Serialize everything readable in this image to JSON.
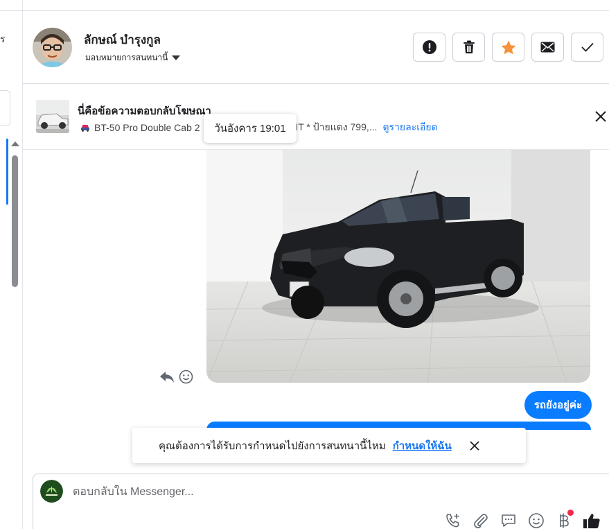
{
  "left_strip": {
    "cut_text": "ร"
  },
  "conversation": {
    "contact_name": "ลักษณ์ บำรุงกูล",
    "assign_label": "มอบหมายการสนทนานี้"
  },
  "header_actions": [
    {
      "name": "spam-button",
      "icon": "exclamation-icon"
    },
    {
      "name": "delete-button",
      "icon": "trash-icon"
    },
    {
      "name": "star-button",
      "icon": "star-icon"
    },
    {
      "name": "mark-unread-button",
      "icon": "envelope-icon"
    },
    {
      "name": "mark-done-button",
      "icon": "check-icon"
    }
  ],
  "ad_reply": {
    "title": "นี่คือข้อความตอบกลับโฆษณา",
    "subtitle_start": "BT-50 Pro Double Cab 2",
    "subtitle_end": "MT * ป้ายแดง 799,...",
    "details_link": "ดูรายละเอียด"
  },
  "tooltip": {
    "text": "วันอังคาร 19:01"
  },
  "messages": [
    {
      "type": "image",
      "subject": "black pickup truck in showroom"
    },
    {
      "type": "text",
      "from": "page",
      "text": "รถยังอยู่ค่ะ"
    }
  ],
  "toast": {
    "text": "คุณต้องการได้รับการกำหนดไปยังการสนทนานี้ไหม",
    "link": "กำหนดให้ฉัน"
  },
  "composer": {
    "placeholder": "ตอบกลับใน Messenger..."
  },
  "composer_tools": [
    "phone-plus-icon",
    "paperclip-icon",
    "chat-bubble-icon",
    "smiley-icon",
    "baht-icon",
    "thumbs-up-icon"
  ],
  "colors": {
    "accent": "#1877f2",
    "bubble": "#0a7cff",
    "star": "#f7923a",
    "notification": "#f02849"
  }
}
